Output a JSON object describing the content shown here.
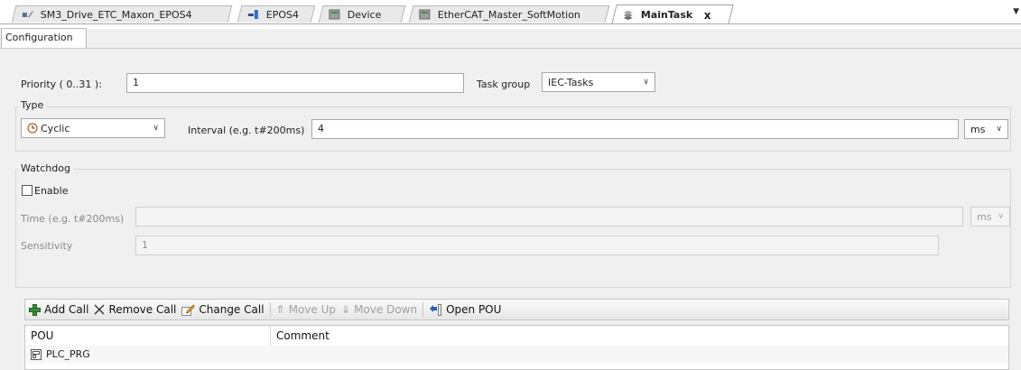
{
  "tabs": [
    {
      "label": "SM3_Drive_ETC_Maxon_EPOS4",
      "icon": "drive-icon"
    },
    {
      "label": "EPOS4",
      "icon": "axis-icon"
    },
    {
      "label": "Device",
      "icon": "device-icon"
    },
    {
      "label": "EtherCAT_Master_SoftMotion",
      "icon": "ethercat-master-icon"
    },
    {
      "label": "MainTask",
      "icon": "task-icon",
      "active": true,
      "close": "x"
    }
  ],
  "subtab": "Configuration",
  "priority": {
    "label": "Priority ( 0..31 ):",
    "value": "1"
  },
  "task_group": {
    "label": "Task group",
    "value": "IEC-Tasks"
  },
  "type": {
    "title": "Type",
    "value": "Cyclic",
    "interval_label": "Interval (e.g. t#200ms)",
    "interval_value": "4",
    "unit": "ms"
  },
  "watchdog": {
    "title": "Watchdog",
    "enable_label": "Enable",
    "enabled": false,
    "time_label": "Time (e.g. t#200ms)",
    "time_value": "",
    "time_unit": "ms",
    "sensitivity_label": "Sensitivity",
    "sensitivity_value": "1"
  },
  "toolbar": {
    "add_call": "Add Call",
    "remove_call": "Remove Call",
    "change_call": "Change Call",
    "move_up": "Move Up",
    "move_down": "Move Down",
    "open_pou": "Open POU"
  },
  "table": {
    "columns": [
      "POU",
      "Comment"
    ],
    "rows": [
      {
        "pou": "PLC_PRG",
        "comment": ""
      }
    ]
  }
}
